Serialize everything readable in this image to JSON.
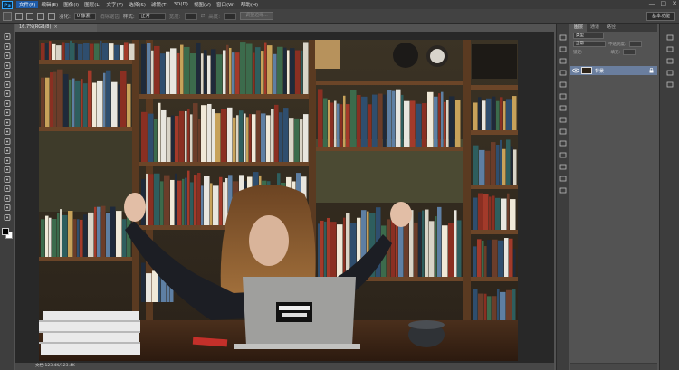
{
  "app": {
    "logo": "Ps",
    "menu": [
      "文件(F)",
      "编辑(E)",
      "图像(I)",
      "图层(L)",
      "文字(Y)",
      "选择(S)",
      "滤镜(T)",
      "3D(D)",
      "视图(V)",
      "窗口(W)",
      "帮助(H)"
    ],
    "active_menu_index": 0,
    "window_controls": [
      "—",
      "□",
      "✕"
    ]
  },
  "options": {
    "feather_label": "羽化:",
    "feather_value": "0 像素",
    "antialias_label": "消除锯齿",
    "style_label": "样式:",
    "style_value": "正常",
    "width_label": "宽度:",
    "height_label": "高度:",
    "refine_edge": "调整边缘...",
    "workspace": "基本功能"
  },
  "document": {
    "tab_label": "16.7%(RGB/8)",
    "tab_close": "×",
    "status": "文档:123.4K/123.4K"
  },
  "panel": {
    "tabs": [
      "图层",
      "通道",
      "路径"
    ],
    "filter_label": "类型",
    "blend_mode": "正常",
    "opacity_label": "不透明度:",
    "lock_label": "锁定:",
    "fill_label": "填充:",
    "layer_name": "背景"
  },
  "icons": {
    "tools": [
      "move-icon",
      "marquee-icon",
      "lasso-icon",
      "quick-select-icon",
      "crop-icon",
      "eyedropper-icon",
      "healing-icon",
      "brush-icon",
      "clone-stamp-icon",
      "history-brush-icon",
      "eraser-icon",
      "gradient-icon",
      "blur-icon",
      "dodge-icon",
      "pen-icon",
      "type-icon",
      "path-select-icon",
      "rectangle-icon",
      "hand-icon",
      "zoom-icon"
    ]
  }
}
